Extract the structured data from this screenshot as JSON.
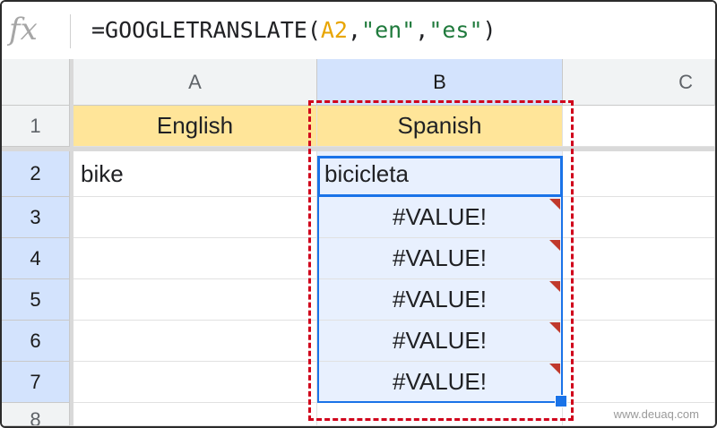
{
  "formula_bar": {
    "icon": "fx-icon",
    "formula_prefix": "=GOOGLETRANSLATE(",
    "formula_ref": "A2",
    "formula_sep1": ",",
    "formula_lit1": "\"en\"",
    "formula_sep2": ",",
    "formula_lit2": "\"es\"",
    "formula_suffix": ")"
  },
  "columns": [
    "A",
    "B",
    "C"
  ],
  "rows": [
    "1",
    "2",
    "3",
    "4",
    "5",
    "6",
    "7",
    "8"
  ],
  "cells": {
    "A1": "English",
    "B1": "Spanish",
    "A2": "bike",
    "B2": "bicicleta",
    "B3": "#VALUE!",
    "B4": "#VALUE!",
    "B5": "#VALUE!",
    "B6": "#VALUE!",
    "B7": "#VALUE!"
  },
  "colors": {
    "header_fill": "#ffe599",
    "selection_border": "#1a73e8",
    "selection_fill": "#e8f0fe",
    "error_marker": "#c0392b",
    "callout_border": "#d0021b",
    "formula_ref": "#e8a500"
  },
  "watermark": "www.deuaq.com"
}
